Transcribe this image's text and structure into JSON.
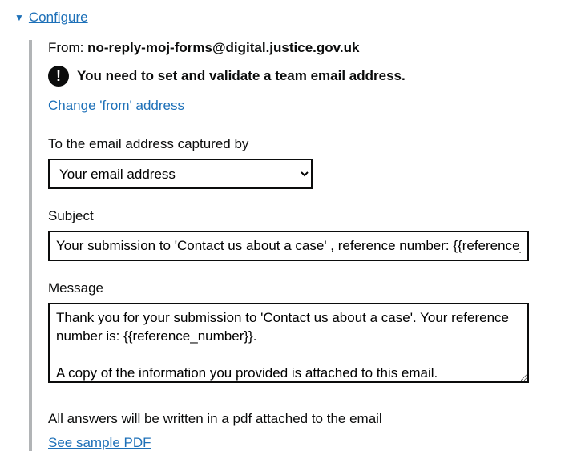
{
  "header": {
    "configure_label": "Configure"
  },
  "from": {
    "label": "From: ",
    "email": "no-reply-moj-forms@digital.justice.gov.uk"
  },
  "warning": {
    "icon_glyph": "!",
    "text": "You need to set and validate a team email address."
  },
  "change_from": {
    "label": "Change 'from' address"
  },
  "to_field": {
    "label": "To the email address captured by",
    "selected": "Your email address"
  },
  "subject_field": {
    "label": "Subject",
    "value": "Your submission to 'Contact us about a case' , reference number: {{reference_number}}"
  },
  "message_field": {
    "label": "Message",
    "value": "Thank you for your submission to 'Contact us about a case'. Your reference number is: {{reference_number}}.\n\nA copy of the information you provided is attached to this email."
  },
  "footer": {
    "helper_text": "All answers will be written in a pdf attached to the email",
    "sample_link": "See sample PDF"
  }
}
